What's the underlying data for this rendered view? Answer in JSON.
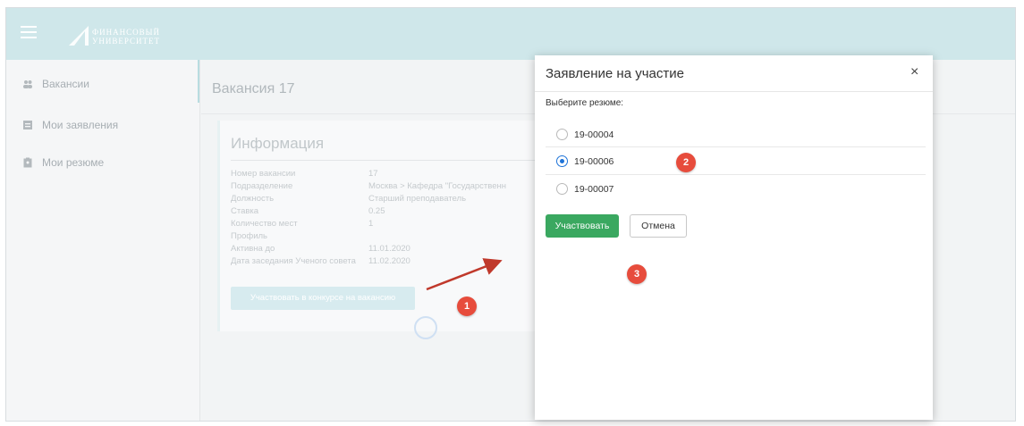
{
  "header": {
    "logo_line1": "ФИНАНСОВЫЙ",
    "logo_line2": "УНИВЕРСИТЕТ"
  },
  "sidebar": {
    "items": [
      {
        "label": "Вакансии",
        "icon": "people-icon"
      },
      {
        "label": "Мои заявления",
        "icon": "document-icon"
      },
      {
        "label": "Мои резюме",
        "icon": "clipboard-icon"
      }
    ]
  },
  "main": {
    "title": "Вакансия 17",
    "info_heading": "Информация",
    "fields": [
      {
        "key": "Номер вакансии",
        "value": "17"
      },
      {
        "key": "Подразделение",
        "value": "Москва > Кафедра \"Государственн"
      },
      {
        "key": "Должность",
        "value": "Старший преподаватель"
      },
      {
        "key": "Ставка",
        "value": "0.25"
      },
      {
        "key": "Количество мест",
        "value": "1"
      },
      {
        "key": "Профиль",
        "value": ""
      },
      {
        "key": "Активна до",
        "value": "11.01.2020"
      },
      {
        "key": "Дата заседания Ученого совета",
        "value": "11.02.2020"
      }
    ],
    "apply_button": "Участвовать в конкурсе на вакансию"
  },
  "modal": {
    "title": "Заявление на участие",
    "close_symbol": "×",
    "choose_label": "Выберите резюме:",
    "options": [
      {
        "label": "19-00004",
        "checked": false
      },
      {
        "label": "19-00006",
        "checked": true
      },
      {
        "label": "19-00007",
        "checked": false
      }
    ],
    "submit_label": "Участвовать",
    "cancel_label": "Отмена"
  },
  "annotations": [
    "1",
    "2",
    "3"
  ],
  "colors": {
    "topbar": "#cfe7ea",
    "primary_green": "#3aa860",
    "radio_blue": "#1e73d8",
    "annotation_red": "#e74c3c"
  }
}
